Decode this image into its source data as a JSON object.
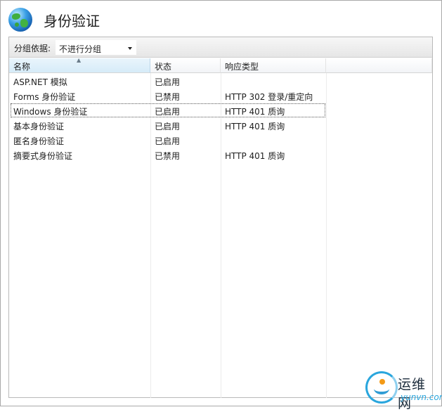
{
  "header": {
    "title": "身份验证",
    "icon": "globe-icon"
  },
  "toolbar": {
    "group_label": "分组依据:",
    "group_value": "不进行分组"
  },
  "columns": {
    "name": "名称",
    "status": "状态",
    "response": "响应类型"
  },
  "rows": [
    {
      "name": "ASP.NET 模拟",
      "status": "已启用",
      "response": ""
    },
    {
      "name": "Forms 身份验证",
      "status": "已禁用",
      "response": "HTTP 302 登录/重定向"
    },
    {
      "name": "Windows 身份验证",
      "status": "已启用",
      "response": "HTTP 401 质询"
    },
    {
      "name": "基本身份验证",
      "status": "已启用",
      "response": "HTTP 401 质询"
    },
    {
      "name": "匿名身份验证",
      "status": "已启用",
      "response": ""
    },
    {
      "name": "摘要式身份验证",
      "status": "已禁用",
      "response": "HTTP 401 质询"
    }
  ],
  "selected_row": 2,
  "watermark": {
    "cn": "运维网",
    "en": "yunvn.com"
  },
  "colors": {
    "accent": "#2aa6dd",
    "header_sorted": "#d6ebf8"
  }
}
